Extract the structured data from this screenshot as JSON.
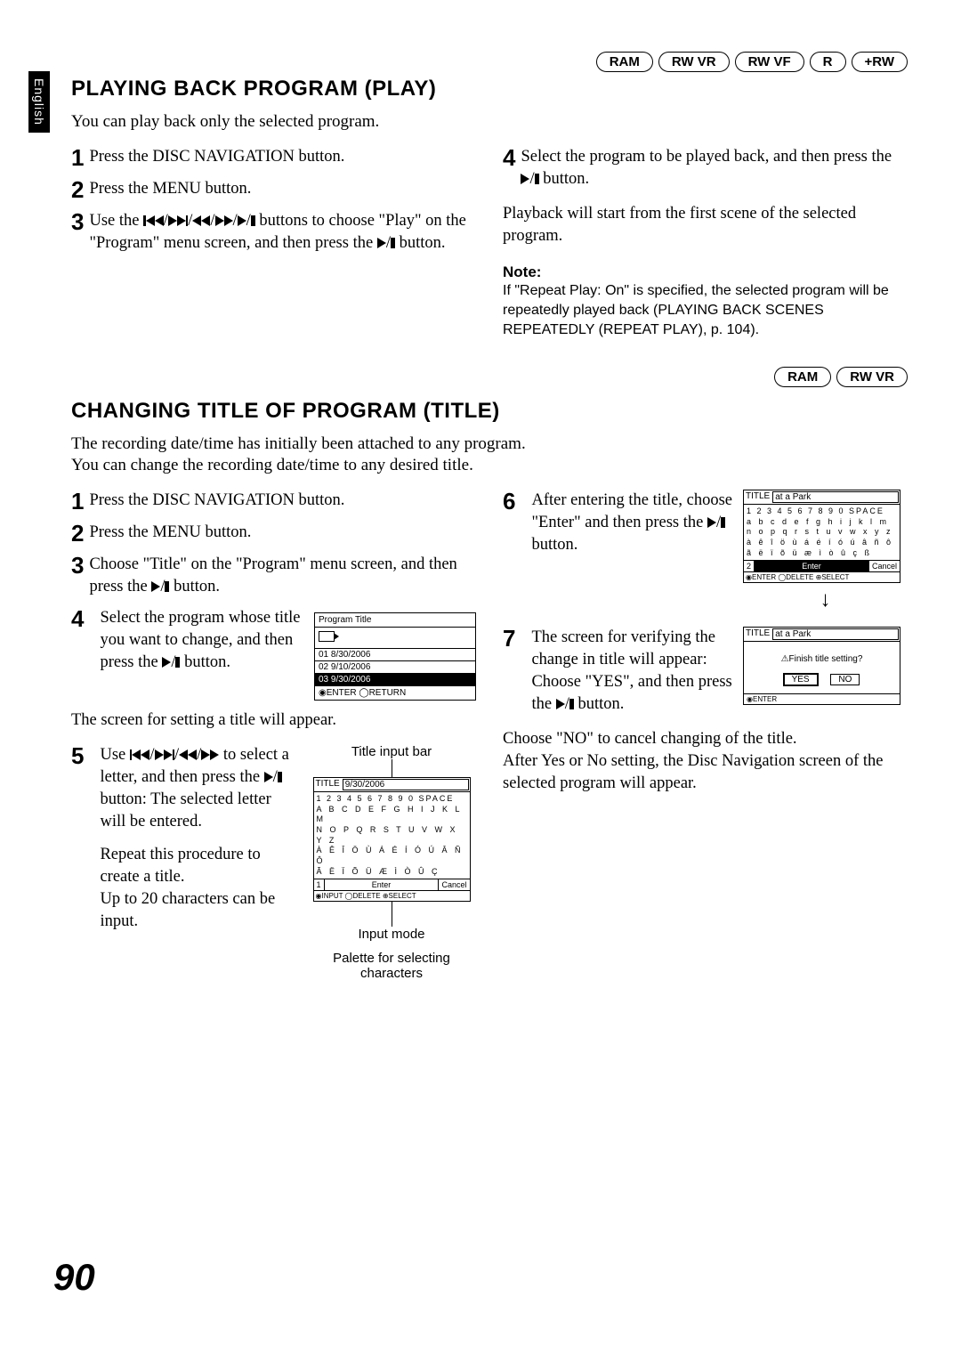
{
  "side_tab": "English",
  "badges_top": {
    "b1": "RAM",
    "b2": "RW VR",
    "b3": "RW VF",
    "b4": "R",
    "b5": "+RW"
  },
  "badges_mid": {
    "b1": "RAM",
    "b2": "RW VR"
  },
  "section1": {
    "heading": "PLAYING BACK PROGRAM (PLAY)",
    "intro": "You can play back only the selected program.",
    "step1": "Press the DISC NAVIGATION button.",
    "step2": "Press the MENU button.",
    "step3a": "Use the ",
    "step3b": " buttons to choose \"Play\" on the \"Program\" menu screen, and then press the ",
    "step3c": " button.",
    "step4a": "Select the program to be played back, and then press the ",
    "step4b": " button.",
    "step4_after": "Playback will start from the first scene of the selected program.",
    "note_h": "Note:",
    "note_b": "If \"Repeat Play: On\" is specified, the selected program will be repeatedly played back (PLAYING BACK SCENES REPEATEDLY (REPEAT PLAY), p. 104)."
  },
  "section2": {
    "heading": "CHANGING TITLE OF PROGRAM (TITLE)",
    "intro1": "The recording date/time has initially been attached to any program.",
    "intro2": "You can change the recording date/time to any desired title.",
    "step1": "Press the DISC NAVIGATION button.",
    "step2": "Press the MENU button.",
    "step3a": "Choose \"Title\" on the \"Program\" menu screen, and then press the ",
    "step3b": " button.",
    "step4a": "Select the program whose title you want to change, and then press the ",
    "step4b": " button.",
    "step4_after": "The screen for setting a title will appear.",
    "step5a": "Use ",
    "step5b": " to select a letter, and then press the ",
    "step5c": " button: The selected letter will be entered.",
    "step5_after1": "Repeat this procedure to create a title.",
    "step5_after2": "Up to 20 characters can be input.",
    "step6a": "After entering the title, choose \"Enter\" and then press the ",
    "step6b": " button.",
    "step7a": "The screen for verifying the change in title will appear: Choose \"YES\", and then press the ",
    "step7b": " button.",
    "step7_after1": "Choose \"NO\" to cancel changing of the title.",
    "step7_after2": "After Yes or No setting, the Disc Navigation screen of the selected program will appear."
  },
  "program_box": {
    "header": "Program Title",
    "r1": "01    8/30/2006",
    "r2": "02    9/10/2006",
    "r3": "03    9/30/2006",
    "footer": "◉ENTER  ◯RETURN"
  },
  "title_edit": {
    "lbl": "TITLE",
    "field": "9/30/2006",
    "pal1": "1 2 3 4 5 6 7 8 9 0 SPACE",
    "pal2": "A B C D E F G H I J K L M",
    "pal3": "N O P Q R S T U V W X Y Z",
    "pal4": "À Ê Î Ö Ù Á É Í Ó Ú Â Ñ Ô",
    "pal5": "Ã Ë Ï Õ Ü Æ Ì Ò Û Ç",
    "btn1": "1",
    "btn2": "Enter",
    "btn3": "Cancel",
    "ftr": "◉INPUT ◯DELETE ⊕SELECT",
    "callout_top": "Title input bar",
    "callout_mode": "Input mode",
    "callout_palette": "Palette for selecting characters"
  },
  "title_edit2": {
    "lbl": "TITLE",
    "field": "at a Park",
    "pal1": "1 2 3 4 5 6 7 8 9 0 SPACE",
    "pal2": "a b c d e f g h i j k l m",
    "pal3": "n o p q r s t u v w x y z",
    "pal4": "à ê î ö ù á é í ó ú â ñ ô",
    "pal5": "ã ë ï õ ü æ ì ò û ç ß",
    "btn1": "2",
    "btn2": "Enter",
    "btn3": "Cancel",
    "ftr": "◉ENTER ◯DELETE ⊕SELECT"
  },
  "confirm": {
    "lbl": "TITLE",
    "field": "at a Park",
    "q": "⚠Finish title setting?",
    "yes": "YES",
    "no": "NO",
    "ftr": "◉ENTER"
  },
  "page_num": "90"
}
